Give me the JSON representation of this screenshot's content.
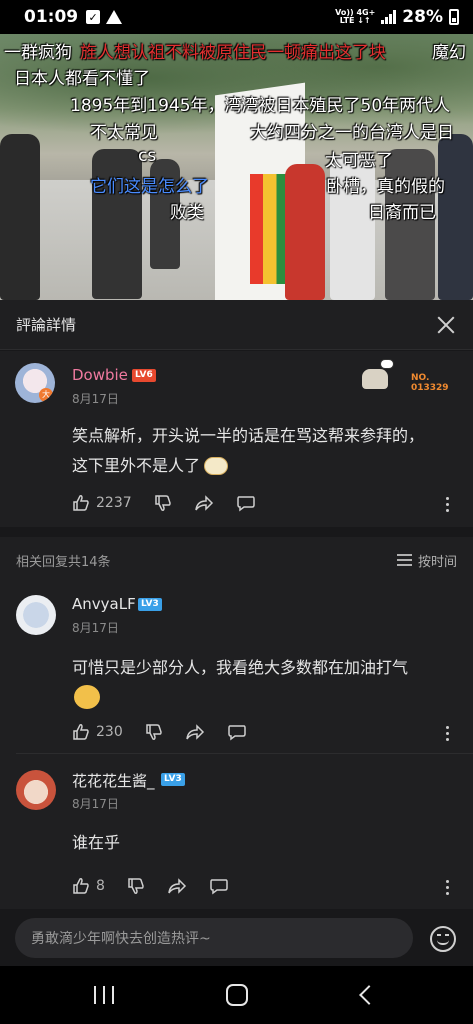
{
  "status_bar": {
    "time": "01:09",
    "network_top": "Vo)) 4G+",
    "network_bottom": "LTE ↓↑",
    "battery": "28%"
  },
  "video": {
    "danmaku": [
      {
        "text": "一群疯狗",
        "color": "white"
      },
      {
        "text": "旌人想认祖不料被原住民一顿痛出这了块",
        "color": "red"
      },
      {
        "text": "魔幻",
        "color": "white"
      },
      {
        "text": "日本人都看不懂了",
        "color": "white"
      },
      {
        "text": "1895年到1945年，湾湾被日本殖民了50年两代人",
        "color": "white"
      },
      {
        "text": "不太常见",
        "color": "white"
      },
      {
        "text": "大约四分之一的台湾人是日",
        "color": "white"
      },
      {
        "text": "cs",
        "color": "white"
      },
      {
        "text": "太可恶了",
        "color": "white"
      },
      {
        "text": "它们这是怎么了",
        "color": "blue"
      },
      {
        "text": "卧槽，真的假的",
        "color": "white"
      },
      {
        "text": "败类",
        "color": "white"
      },
      {
        "text": "日裔而已",
        "color": "white"
      }
    ]
  },
  "panel": {
    "title": "評論詳情"
  },
  "main_comment": {
    "username": "Dowbie",
    "level": "LV6",
    "date": "8月17日",
    "badge_no_label": "NO.",
    "badge_no_value": "013329",
    "text_line1": "笑点解析，开头说一半的话是在骂这帮来参拜的，",
    "text_line2": "这下里外不是人了",
    "likes": "2237"
  },
  "replies": {
    "count_label": "相关回复共14条",
    "sort_label": "按时间",
    "items": [
      {
        "username": "AnvyaLF",
        "level": "LV3",
        "date": "8月17日",
        "text": "可惜只是少部分人，我看绝大多数都在加油打气",
        "likes": "230"
      },
      {
        "username": "花花花生酱_",
        "level": "LV3",
        "date": "8月17日",
        "text": "谁在乎",
        "likes": "8"
      }
    ]
  },
  "input": {
    "placeholder": "勇敢滴少年啊快去创造热评~"
  },
  "colors": {
    "accent_pink": "#f07aa0",
    "level_red": "#e8492f",
    "level_blue": "#3aa0e8",
    "panel_bg": "#1f1f21"
  }
}
